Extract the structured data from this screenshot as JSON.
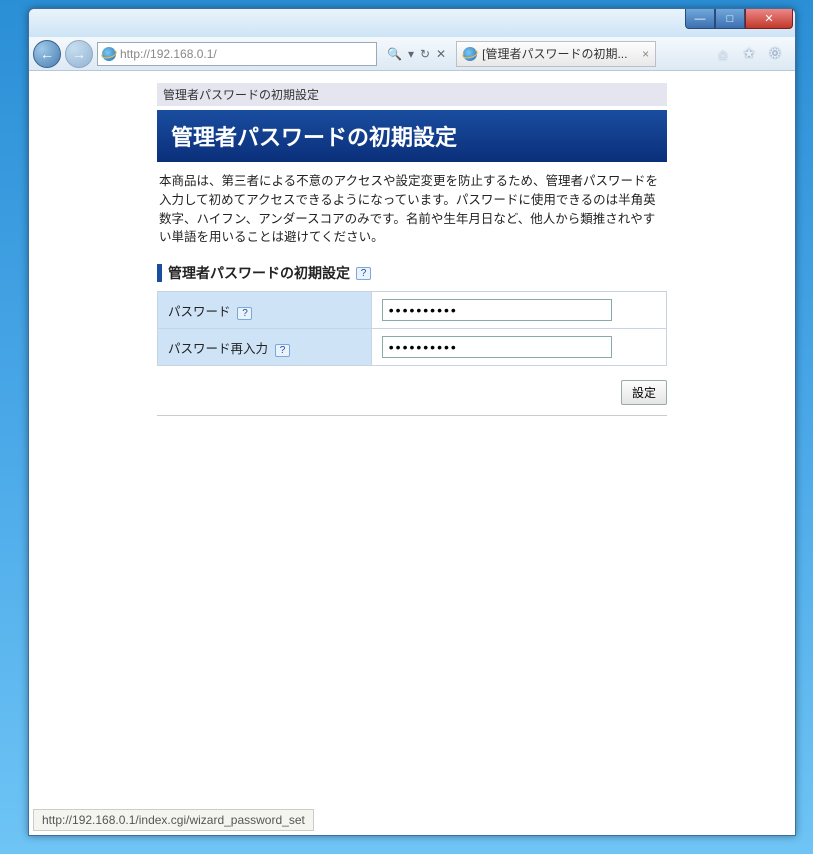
{
  "window": {
    "minimize": "—",
    "maximize": "□",
    "close": "✕"
  },
  "nav": {
    "back": "←",
    "forward": "→",
    "url": "http://192.168.0.1/",
    "search_icon": "🔍",
    "refresh": "↻",
    "stop": "✕"
  },
  "tab": {
    "title": "[管理者パスワードの初期...",
    "close": "×"
  },
  "toolbar": {
    "home": "⌂",
    "star": "★",
    "gear": "⚙"
  },
  "page": {
    "breadcrumb": "管理者パスワードの初期設定",
    "title": "管理者パスワードの初期設定",
    "description": "本商品は、第三者による不意のアクセスや設定変更を防止するため、管理者パスワードを入力して初めてアクセスできるようになっています。パスワードに使用できるのは半角英数字、ハイフン、アンダースコアのみです。名前や生年月日など、他人から類推されやすい単語を用いることは避けてください。",
    "section_title": "管理者パスワードの初期設定",
    "help": "?",
    "fields": {
      "password_label": "パスワード",
      "password_value": "••••••••••",
      "confirm_label": "パスワード再入力",
      "confirm_value": "••••••••••"
    },
    "submit": "設定"
  },
  "status": "http://192.168.0.1/index.cgi/wizard_password_set"
}
